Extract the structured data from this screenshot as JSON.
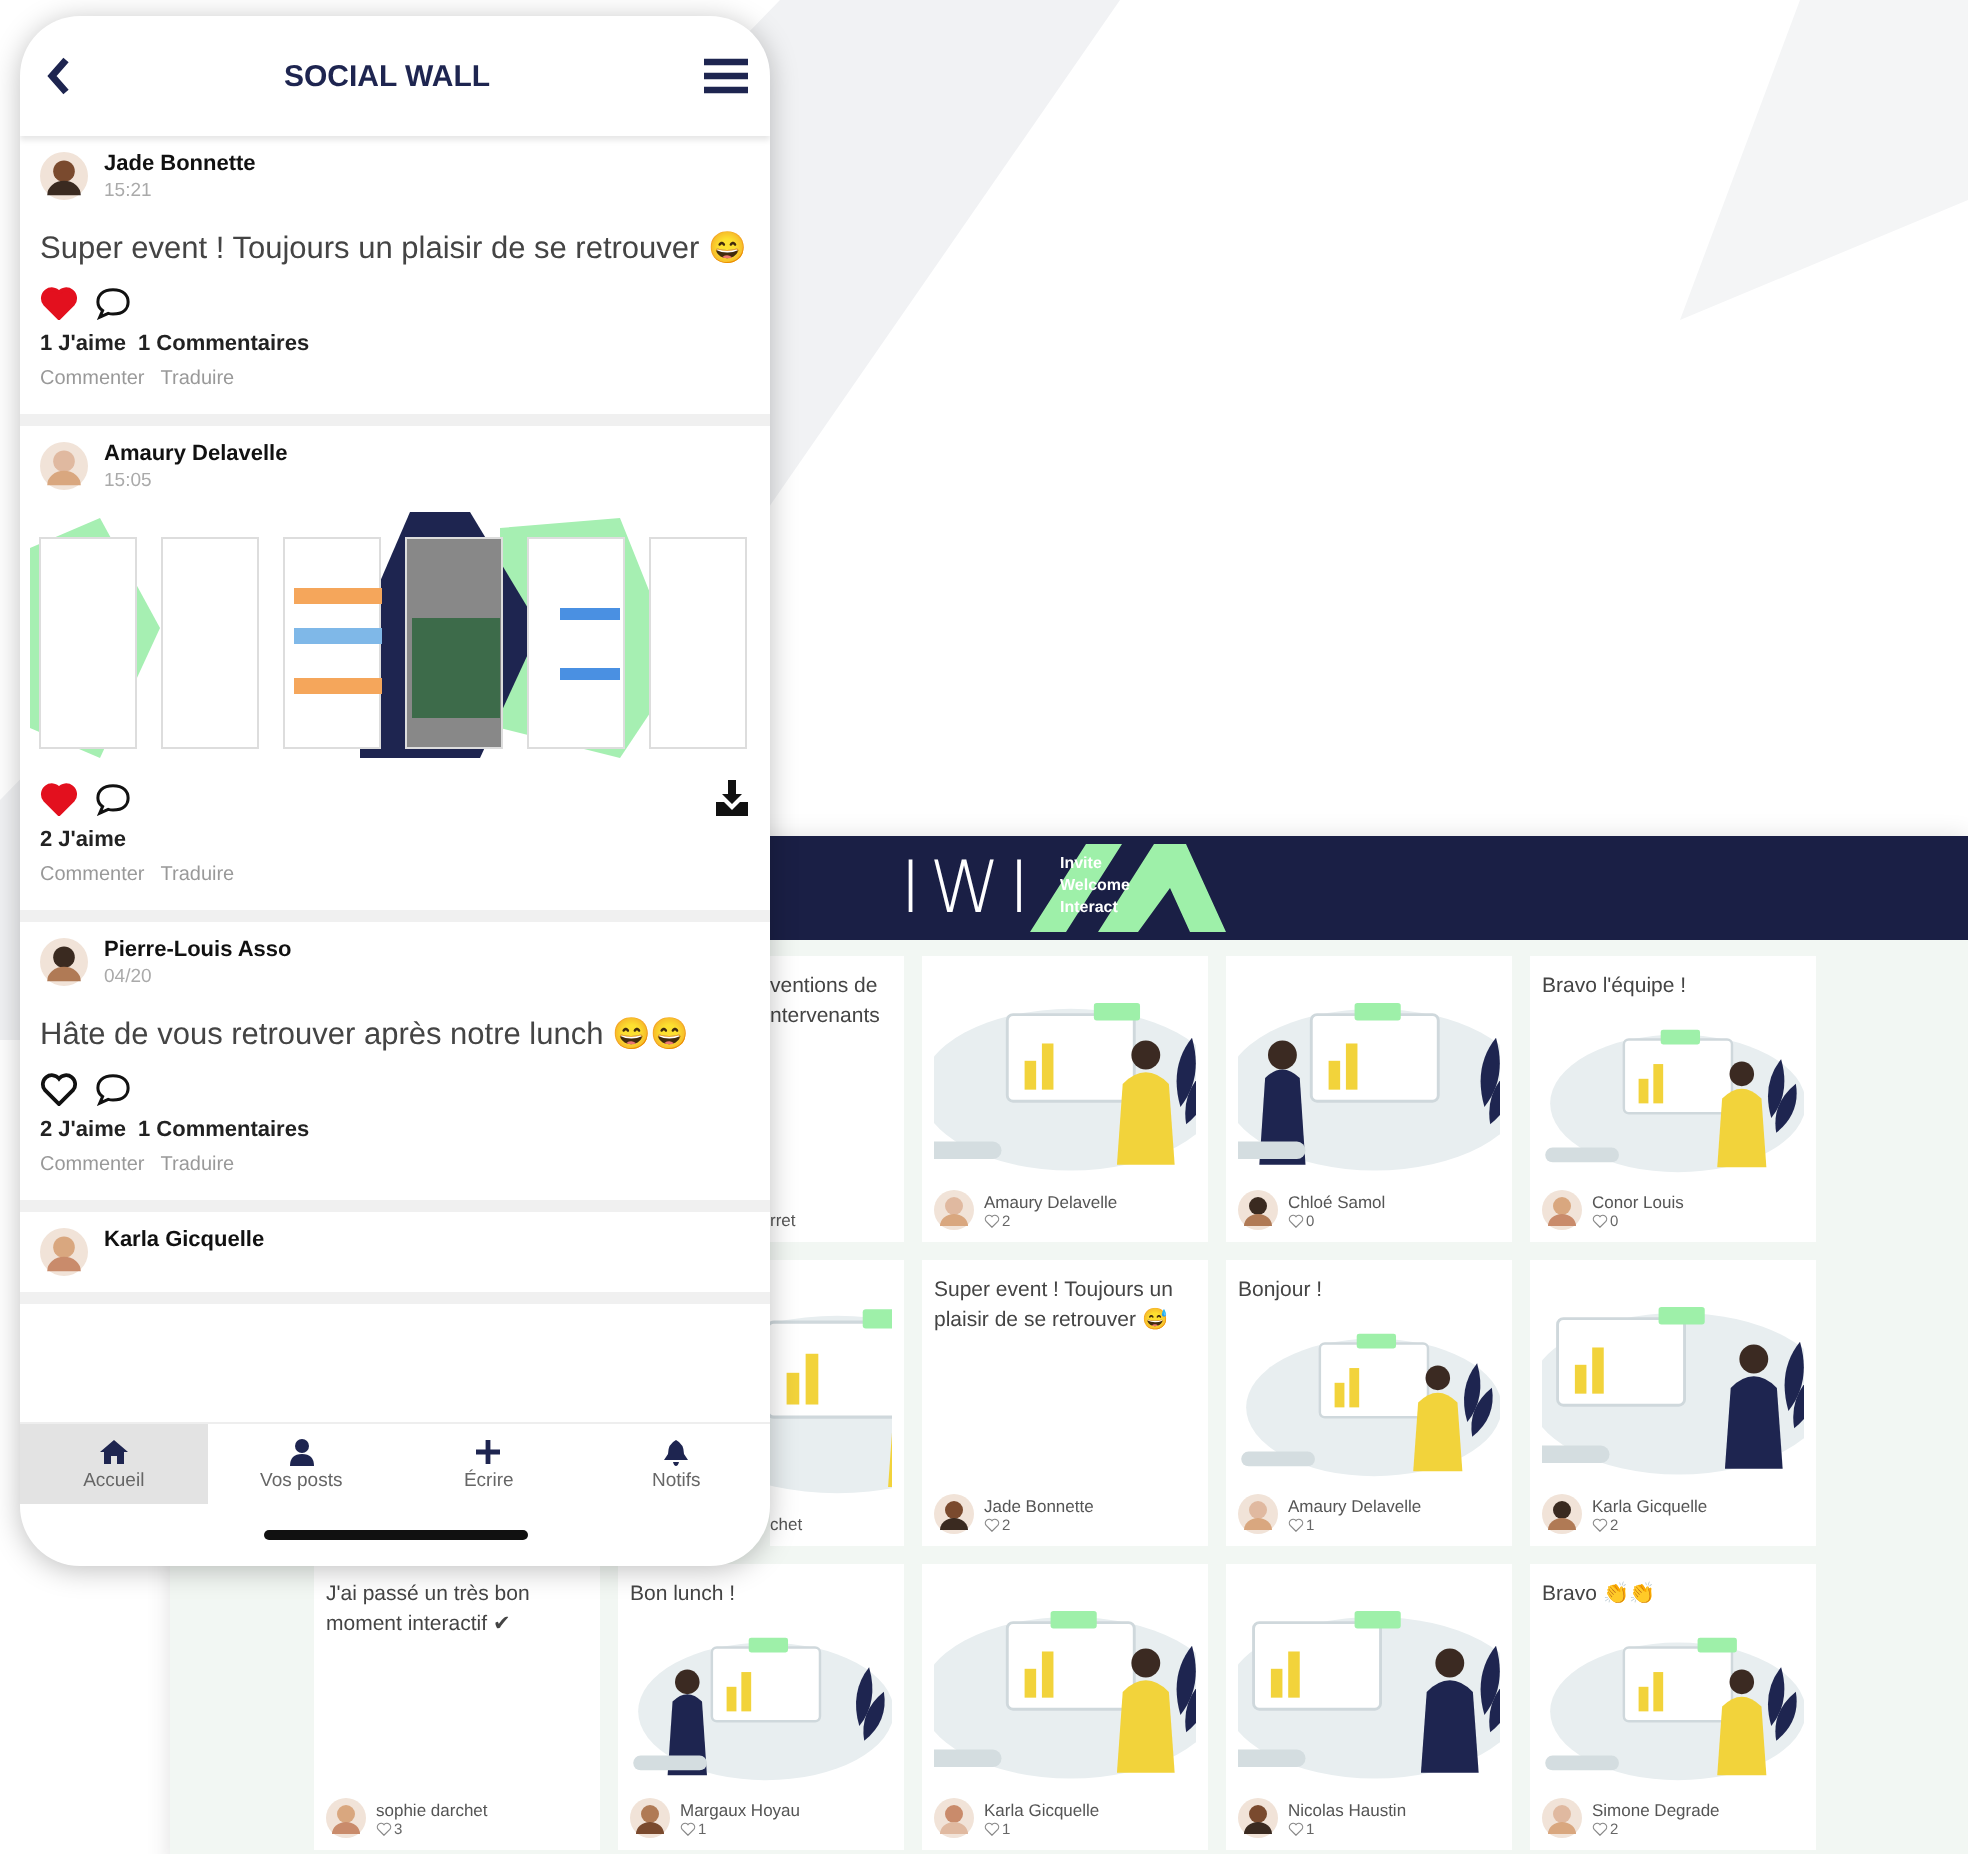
{
  "phone": {
    "title": "SOCIAL WALL",
    "posts": [
      {
        "author": "Jade Bonnette",
        "time": "15:21",
        "kind": "text",
        "message": "Super event ! Toujours un plaisir de se retrouver 😄",
        "liked": true,
        "likes": "1 J'aime",
        "comments": "1 Commentaires",
        "actions": [
          "Commenter",
          "Traduire"
        ]
      },
      {
        "author": "Amaury Delavelle",
        "time": "15:05",
        "liked": true,
        "likes": "2 J'aime",
        "actions": [
          "Commenter",
          "Traduire"
        ]
      },
      {
        "author": "Pierre-Louis Asso",
        "time": "04/20",
        "kind": "text",
        "message": "Hâte de vous retrouver après notre lunch 😄😄",
        "liked": false,
        "likes": "2 J'aime",
        "comments": "1 Commentaires",
        "actions": [
          "Commenter",
          "Traduire"
        ]
      },
      {
        "author": "Karla Gicquelle",
        "kind": "text"
      }
    ],
    "nav": [
      {
        "label": "Accueil",
        "selected": true
      },
      {
        "label": "Vos posts",
        "selected": false
      },
      {
        "label": "Écrire",
        "selected": false
      },
      {
        "label": "Notifs",
        "selected": false
      }
    ]
  },
  "wall": {
    "logo": "IWI",
    "tagline": [
      "Invite",
      "Welcome",
      "Interact"
    ],
    "rows": [
      [
        "",
        {
          "kind": "clipped",
          "message": "ventions de ntervenants",
          "author": "rret"
        },
        {
          "kind": "picture",
          "author": "Amaury Delavelle",
          "likes": "2"
        },
        {
          "kind": "picture",
          "author": "Chloé Samol",
          "likes": "0"
        },
        {
          "kind": "picture",
          "message": "Bravo l'équipe !",
          "author": "Conor Louis",
          "likes": "0"
        }
      ],
      [
        "",
        {
          "kind": "clipped",
          "author": "chet"
        },
        {
          "kind": "note",
          "message": "Super event ! Toujours un plaisir de se retrouver 😅",
          "author": "Jade Bonnette",
          "likes": "2"
        },
        {
          "kind": "picture",
          "message": "Bonjour !",
          "author": "Amaury Delavelle",
          "likes": "1"
        },
        {
          "kind": "picture",
          "author": "Karla Gicquelle",
          "likes": "2"
        }
      ],
      [
        {
          "kind": "note",
          "message": "J'ai passé un très bon moment interactif ✔",
          "author": "sophie darchet",
          "likes": "3"
        },
        {
          "kind": "picture",
          "message": "Bon lunch !",
          "author": "Margaux Hoyau",
          "likes": "1"
        },
        {
          "kind": "picture",
          "author": "Karla Gicquelle",
          "likes": "1"
        },
        {
          "kind": "picture",
          "author": "Nicolas Haustin",
          "likes": "1"
        },
        {
          "kind": "picture",
          "message": "Bravo 👏👏",
          "author": "Simone Degrade",
          "likes": "2"
        }
      ]
    ]
  }
}
